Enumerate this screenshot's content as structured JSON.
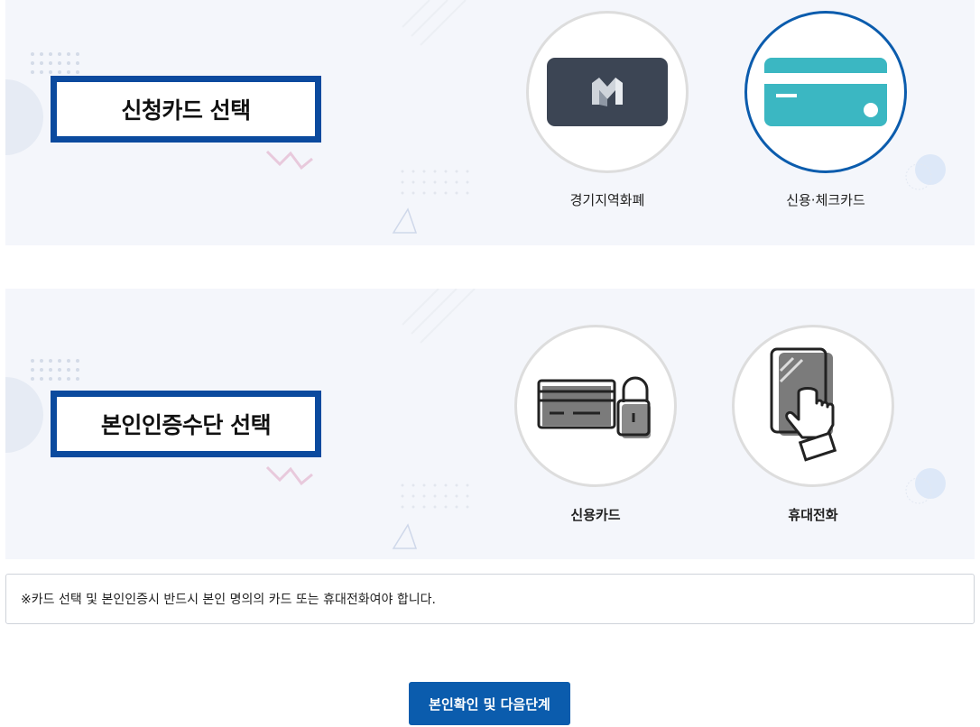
{
  "card_section": {
    "title": "신청카드 선택",
    "options": [
      {
        "label": "경기지역화폐",
        "selected": false,
        "icon": "gyeonggi-local-currency-card-icon"
      },
      {
        "label": "신용·체크카드",
        "selected": true,
        "icon": "credit-check-card-icon"
      }
    ]
  },
  "auth_section": {
    "title": "본인인증수단 선택",
    "options": [
      {
        "label": "신용카드",
        "icon": "credit-card-lock-icon"
      },
      {
        "label": "휴대전화",
        "icon": "mobile-phone-touch-icon"
      }
    ]
  },
  "notice": "※카드 선택 및 본인인증시 반드시 본인 명의의 카드 또는 휴대전화여야 합니다.",
  "next_button": "본인확인 및 다음단계",
  "colors": {
    "primary": "#0b5cad",
    "title_border": "#0b4a9e",
    "panel_bg": "#f4f6fb",
    "teal_card": "#3bb7c2",
    "dark_card": "#3c4554"
  }
}
